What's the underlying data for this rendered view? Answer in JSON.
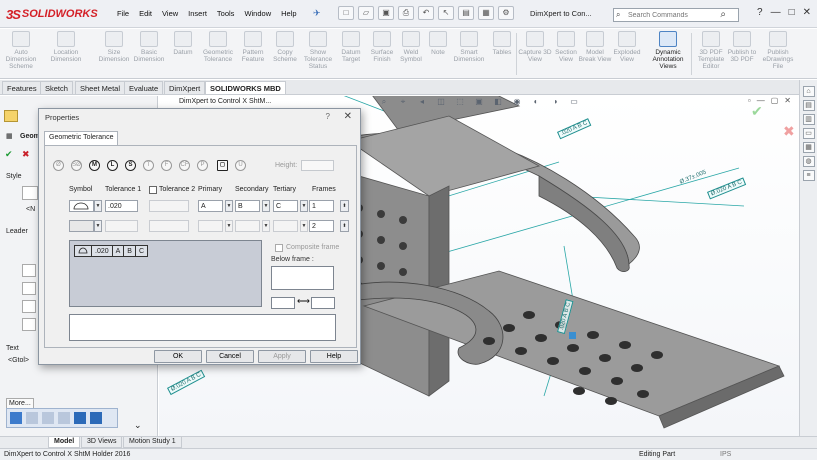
{
  "app": {
    "name": "SOLIDWORKS",
    "logo_mark": "3S",
    "menus": [
      "File",
      "Edit",
      "View",
      "Insert",
      "Tools",
      "Window",
      "Help"
    ],
    "doc_title": "DimXpert to Con...",
    "search_placeholder": "Search Commands",
    "accent": "#d42027"
  },
  "command_manager": [
    {
      "label": "Auto Dimension Scheme"
    },
    {
      "label": "Location Dimension"
    },
    {
      "label": "Size Dimension"
    },
    {
      "label": "Basic Dimension"
    },
    {
      "label": "Datum"
    },
    {
      "label": "Geometric Tolerance"
    },
    {
      "label": "Pattern Feature"
    },
    {
      "label": "Copy Scheme"
    },
    {
      "label": "Show Tolerance Status"
    },
    {
      "label": "Datum Target"
    },
    {
      "label": "Surface Finish"
    },
    {
      "label": "Weld Symbol"
    },
    {
      "label": "Note"
    },
    {
      "label": "Smart Dimension"
    },
    {
      "label": "Tables"
    },
    {
      "label": "Capture 3D View"
    },
    {
      "label": "Section View"
    },
    {
      "label": "Model Break View"
    },
    {
      "label": "Exploded View"
    },
    {
      "label": "Dynamic Annotation Views"
    },
    {
      "label": "3D PDF Template Editor"
    },
    {
      "label": "Publish to 3D PDF"
    },
    {
      "label": "Publish eDrawings File"
    }
  ],
  "tabs": [
    "Features",
    "Sketch",
    "Sheet Metal",
    "Evaluate",
    "DimXpert",
    "SOLIDWORKS MBD"
  ],
  "tree_item": "DimXpert to Control X ShtM...",
  "left_panel": {
    "title": "Geom",
    "style_label": "Style",
    "style_value": "<N",
    "leader_label": "Leader",
    "text_label": "Text",
    "text_value": "<Gtol>",
    "more_label": "More...",
    "ok_icon": "✔",
    "cancel_icon": "✖"
  },
  "dialog": {
    "title": "Properties",
    "help_mark": "?",
    "tab": "Geometric Tolerance",
    "modifiers": [
      "Ø",
      "SØ",
      "M",
      "L",
      "S",
      "T",
      "F",
      "CF",
      "P",
      "◻",
      "U"
    ],
    "height_label": "Height:",
    "columns": {
      "symbol": "Symbol",
      "tol1": "Tolerance 1",
      "tol2": "Tolerance 2",
      "primary": "Primary",
      "secondary": "Secondary",
      "tertiary": "Tertiary",
      "frames": "Frames"
    },
    "row1": {
      "tol1": ".020",
      "primary": "A",
      "secondary": "B",
      "tertiary": "C",
      "frames": "1"
    },
    "row2": {
      "frames": "2"
    },
    "preview_cells": [
      ".020",
      "A",
      "B",
      "C"
    ],
    "composite_label": "Composite frame",
    "below_label": "Below frame :",
    "buttons": {
      "ok": "OK",
      "cancel": "Cancel",
      "apply": "Apply",
      "help": "Help"
    }
  },
  "annotations": {
    "a1": ".020 A B C",
    "a2": "Ø.37±.005",
    "a3": "Ø.020 A B C",
    "a4": ".020 A B C",
    "a5": "Ø.020 A B C"
  },
  "bottom_tabs": [
    "Model",
    "3D Views",
    "Motion Study 1"
  ],
  "status": {
    "doc": "DimXpert to Control X ShtM Holder 2016",
    "mode": "Editing Part",
    "units": "IPS"
  }
}
